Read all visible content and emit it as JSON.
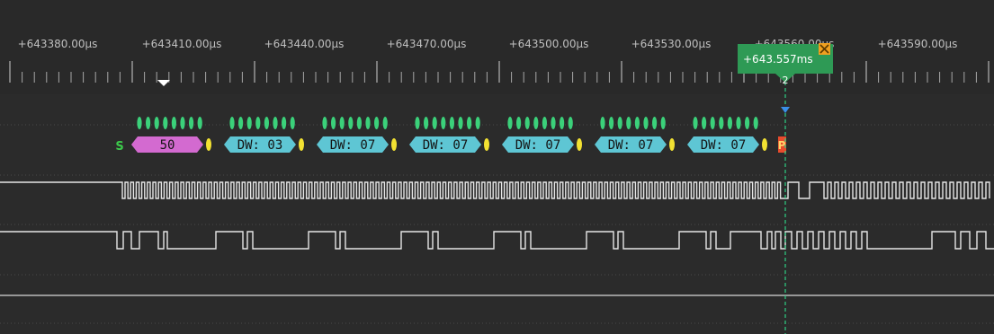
{
  "app": {
    "name": "Logic analyzer waveform view"
  },
  "timeline": {
    "labels": [
      "+643380.00µs",
      "+643410.00µs",
      "+643440.00µs",
      "+643470.00µs",
      "+643500.00µs",
      "+643530.00µs",
      "+643560.00µs",
      "+643590.00µs"
    ]
  },
  "cursor": {
    "label": "+643.557ms",
    "index": "2"
  },
  "decode": {
    "start_label": "S",
    "stop_label": "P",
    "segments": [
      {
        "text": "50",
        "kind": "address",
        "color": "#d36ad0"
      },
      {
        "text": "DW: 03",
        "kind": "data",
        "color": "#5ec6d4"
      },
      {
        "text": "DW: 07",
        "kind": "data",
        "color": "#5ec6d4"
      },
      {
        "text": "DW: 07",
        "kind": "data",
        "color": "#5ec6d4"
      },
      {
        "text": "DW: 07",
        "kind": "data",
        "color": "#5ec6d4"
      },
      {
        "text": "DW: 07",
        "kind": "data",
        "color": "#5ec6d4"
      },
      {
        "text": "DW: 07",
        "kind": "data",
        "color": "#5ec6d4"
      }
    ]
  },
  "colors": {
    "background": "#2b2b2b",
    "ruler_bg": "#292929",
    "signal": "#e6e6e6",
    "cursor": "#2e9a55",
    "cursor_line": "#2ecf84",
    "bits": "#3bd17a",
    "ack": "#f2e132",
    "start": "#3cc94b",
    "stop": "#e84b2c",
    "cursor_close": "#f0a020",
    "trigger_arrow": "#3a8fe8"
  },
  "icons": {
    "cursor_close": "close-icon",
    "trigger": "trigger-arrow-icon",
    "scroll_marker": "position-marker-icon"
  }
}
